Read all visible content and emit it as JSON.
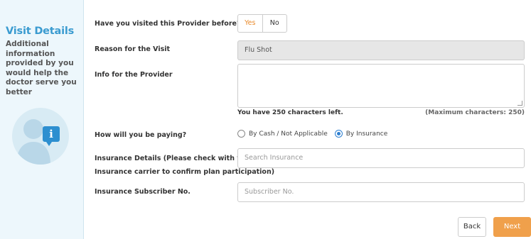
{
  "sidebar": {
    "title": "Visit Details",
    "description": "Additional information provided by you would help the doctor serve you better"
  },
  "form": {
    "visited_before": {
      "label": "Have you visited this Provider before?",
      "yes_label": "Yes",
      "no_label": "No",
      "selected": "Yes"
    },
    "reason": {
      "label": "Reason for the Visit",
      "value": "Flu Shot"
    },
    "info": {
      "label": "Info for the Provider",
      "value": "",
      "chars_left": "You have 250 characters left.",
      "max_chars": "(Maximum characters: 250)"
    },
    "payment": {
      "label": "How will you be paying?",
      "options": [
        "By Cash / Not Applicable",
        "By Insurance"
      ],
      "selected": "By Insurance"
    },
    "insurance": {
      "label_line1": "Insurance Details (Please check with your",
      "label_line2": "Insurance carrier to confirm plan participation)",
      "placeholder": "Search Insurance"
    },
    "subscriber": {
      "label": "Insurance Subscriber No.",
      "placeholder": "Subscriber No."
    }
  },
  "buttons": {
    "back": "Back",
    "next": "Next"
  },
  "colors": {
    "accent_orange": "#f0a04b",
    "title_blue": "#3a9bd0",
    "radio_blue": "#2d7fd0",
    "sidebar_bg": "#edf7fc"
  },
  "icons": {
    "avatar": "user-info-icon",
    "badge": "info-icon"
  }
}
